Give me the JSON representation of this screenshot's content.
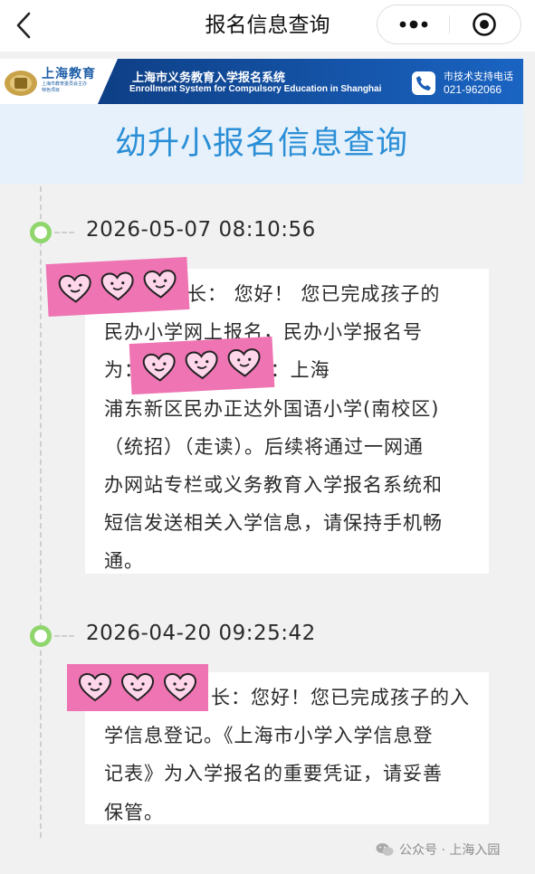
{
  "navbar": {
    "title": "报名信息查询",
    "back_icon": "chevron-left-icon",
    "more_icon": "more-dots-icon",
    "close_icon": "target-close-icon"
  },
  "banner": {
    "logo_title": "上海教育",
    "logo_sub": "上海市教育委员会主办",
    "logo_sub2": "特色项目",
    "system_name_cn": "上海市义务教育入学报名系统",
    "system_name_en": "Enrollment System for Compulsory Education in Shanghai",
    "support_label": "市技术支持电话",
    "support_phone": "021-962066",
    "brand_color": "#1a5fb4"
  },
  "page": {
    "title": "幼升小报名信息查询",
    "title_color": "#2a8ed6",
    "node_color": "#8fd66d",
    "sticker_color": "#ee74b3"
  },
  "timeline": [
    {
      "time": "2026-05-07 08:10:56",
      "lines": [
        "长： 您好！ 您已完成孩子的",
        "民办小学网上报名，民办小学报名号",
        "为： 民办小学志愿：上海",
        "浦东新区民办正达外国语小学(南校区)",
        "（统招）（走读）。后续将通过一网通",
        "办网站专栏或义务教育入学报名系统和",
        "短信发送相关入学信息，请保持手机畅",
        "通。"
      ]
    },
    {
      "time": "2026-04-20 09:25:42",
      "lines": [
        "长：您好！您已完成孩子的入",
        "学信息登记。《上海市小学入学信息登",
        "记表》为入学报名的重要凭证，请妥善",
        "保管。"
      ]
    }
  ],
  "watermark": {
    "text": "公众号 · 上海入园",
    "icon": "wechat-icon"
  }
}
